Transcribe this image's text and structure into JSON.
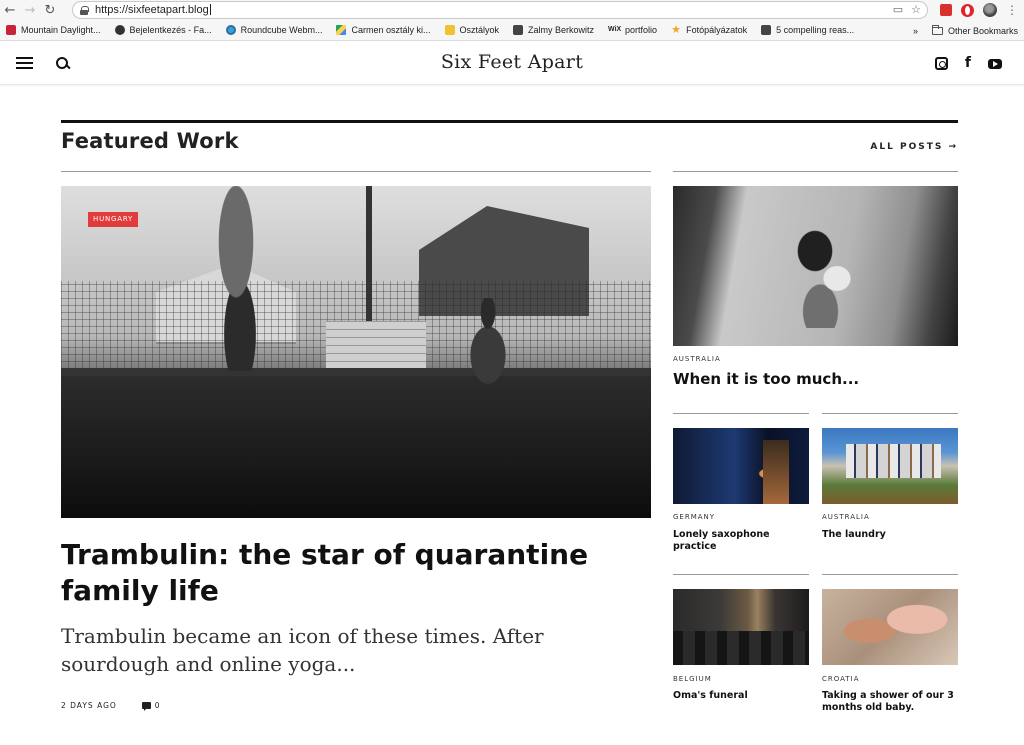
{
  "browser": {
    "url": "https://sixfeetapart.blog",
    "bookmarks": [
      {
        "label": "Mountain Daylight...",
        "icon": "red-square"
      },
      {
        "label": "Bejelentkezés - Fa...",
        "icon": "globe"
      },
      {
        "label": "Roundcube Webm...",
        "icon": "roundcube"
      },
      {
        "label": "Carmen osztály ki...",
        "icon": "drive"
      },
      {
        "label": "Osztályok",
        "icon": "classroom"
      },
      {
        "label": "Zalmy Berkowitz",
        "icon": "cube"
      },
      {
        "label": "portfolio",
        "icon": "wix"
      },
      {
        "label": "Fotópályázatok",
        "icon": "star"
      },
      {
        "label": "5 compelling reas...",
        "icon": "cube"
      }
    ],
    "overflow_label": "»",
    "other_bookmarks": "Other Bookmarks",
    "wix_text": "WiX"
  },
  "site": {
    "title": "Six Feet Apart"
  },
  "featured": {
    "section_title": "Featured Work",
    "all_posts": "ALL POSTS →",
    "main": {
      "tag": "HUNGARY",
      "headline": "Trambulin: the star of quarantine family life",
      "excerpt": "Trambulin became an icon of these times. After sourdough and online yoga...",
      "date": "2 DAYS AGO",
      "comments": "0"
    },
    "side_main": {
      "category": "AUSTRALIA",
      "headline": "When it is too much..."
    },
    "grid": [
      {
        "category": "GERMANY",
        "headline": "Lonely saxophone practice"
      },
      {
        "category": "AUSTRALIA",
        "headline": "The laundry"
      },
      {
        "category": "BELGIUM",
        "headline": "Oma's funeral"
      },
      {
        "category": "CROATIA",
        "headline": "Taking a shower of our 3 months old baby."
      }
    ]
  },
  "colors": {
    "tag_red": "#e23b3b",
    "text": "#111111",
    "rule": "#999999"
  }
}
